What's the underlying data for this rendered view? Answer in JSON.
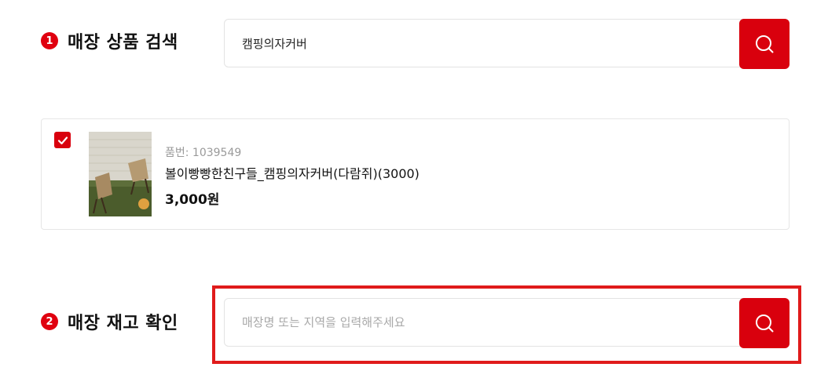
{
  "step1": {
    "number": "1",
    "title": "매장 상품 검색"
  },
  "product_search": {
    "value": "캠핑의자커버",
    "button_icon": "search-icon"
  },
  "product": {
    "checked": true,
    "code": "품번: 1039549",
    "name": "볼이빵빵한친구들_캠핑의자커버(다람쥐)(3000)",
    "price": "3,000원"
  },
  "step2": {
    "number": "2",
    "title": "매장 재고 확인"
  },
  "store_search": {
    "placeholder": "매장명 또는 지역을 입력해주세요",
    "button_icon": "search-icon"
  },
  "colors": {
    "accent": "#d9000d",
    "highlight": "#e01b1b"
  }
}
